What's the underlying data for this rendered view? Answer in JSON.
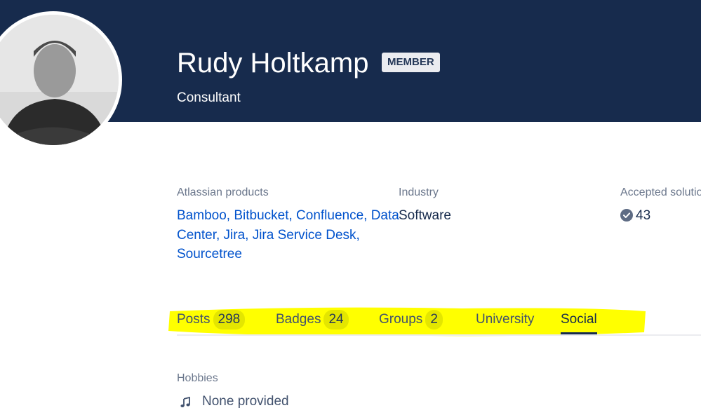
{
  "profile": {
    "name": "Rudy Holtkamp",
    "badge": "MEMBER",
    "role": "Consultant"
  },
  "details": {
    "products_label": "Atlassian products",
    "products_line1": "Bamboo, Bitbucket, Confluence, Data",
    "products_line2": "Center, Jira, Jira Service Desk,",
    "products_line3": "Sourcetree",
    "industry_label": "Industry",
    "industry_value": "Software",
    "solutions_label": "Accepted solutions",
    "solutions_value": "43"
  },
  "tabs": [
    {
      "label": "Posts",
      "count": "298"
    },
    {
      "label": "Badges",
      "count": "24"
    },
    {
      "label": "Groups",
      "count": "2"
    },
    {
      "label": "University"
    },
    {
      "label": "Social"
    }
  ],
  "hobbies": {
    "label": "Hobbies",
    "value": "None provided"
  },
  "colors": {
    "banner": "#172b4d",
    "link": "#0052cc",
    "highlight": "#ffff00"
  },
  "icons": [
    "check-circle-icon",
    "music-note-icon"
  ]
}
